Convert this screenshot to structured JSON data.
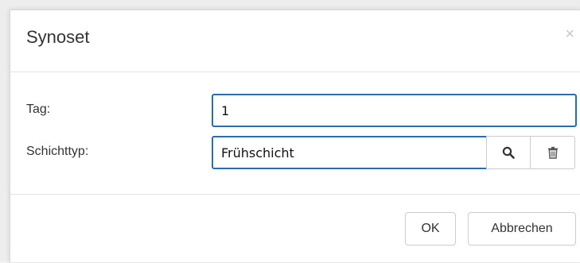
{
  "dialog": {
    "title": "Synoset",
    "close_symbol": "×"
  },
  "form": {
    "tag": {
      "label": "Tag:",
      "value": "1"
    },
    "schichttyp": {
      "label": "Schichttyp:",
      "value": "Frühschicht",
      "search_icon": "search-icon",
      "delete_icon": "trash-icon"
    }
  },
  "footer": {
    "ok_label": "OK",
    "cancel_label": "Abbrechen"
  },
  "colors": {
    "input_focus_border": "#2a6cb0",
    "text": "#333333",
    "close": "#c8c8c8"
  }
}
